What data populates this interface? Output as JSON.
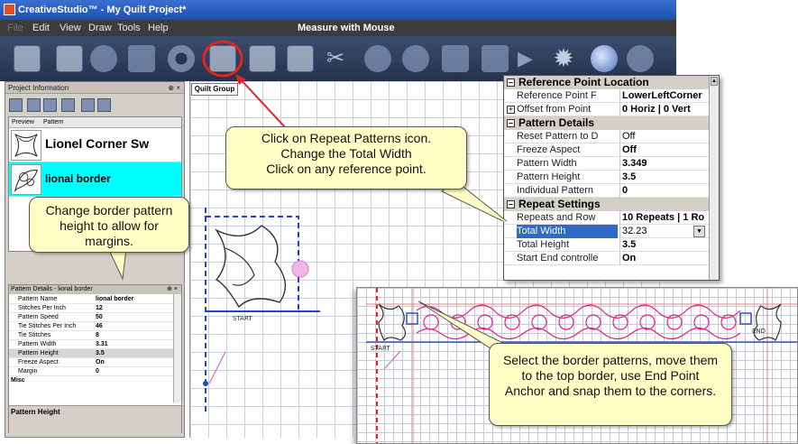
{
  "window": {
    "title": "CreativeStudio™ - My Quilt Project*"
  },
  "menubar": {
    "items": [
      "File",
      "Edit",
      "View",
      "Draw",
      "Tools",
      "Help"
    ],
    "mode_title": "Measure with Mouse"
  },
  "project_panel": {
    "header": "Project Information",
    "pin": "⊕ ×",
    "columns": [
      "Preview",
      "Pattern"
    ],
    "patterns": [
      {
        "name": "Lionel Corner Sw",
        "selected": false
      },
      {
        "name": "lional border",
        "selected": true
      }
    ]
  },
  "pattern_details": {
    "header": "Pattern Details - lional border",
    "pin": "⊕ ×",
    "rows": [
      {
        "label": "Pattern Name",
        "value": "lional border"
      },
      {
        "label": "Stitches Per Inch",
        "value": "12"
      },
      {
        "label": "Pattern Speed",
        "value": "50"
      },
      {
        "label": "Tie Stitches Per Inch",
        "value": "46"
      },
      {
        "label": "Tie Stitches",
        "value": "8"
      },
      {
        "label": "Pattern Width",
        "value": "3.31"
      },
      {
        "label": "Pattern Height",
        "value": "3.5"
      },
      {
        "label": "Freeze Aspect",
        "value": "On"
      },
      {
        "label": "Margin",
        "value": "0"
      }
    ],
    "misc_section": "Misc",
    "footer": "Pattern Height"
  },
  "canvas": {
    "tab": "Quilt Group",
    "start_label": "START"
  },
  "property_grid": {
    "sections": [
      {
        "title": "Reference Point Location",
        "rows": [
          {
            "label": "Reference Point F",
            "value": "LowerLeftCorner",
            "expand": false
          },
          {
            "label": "Offset from Point",
            "value": "0 Horiz | 0 Vert",
            "expand": true
          }
        ]
      },
      {
        "title": "Pattern Details",
        "rows": [
          {
            "label": "Reset Pattern to D",
            "value": "Off"
          },
          {
            "label": "Freeze Aspect",
            "value": "Off"
          },
          {
            "label": "Pattern Width",
            "value": "3.349"
          },
          {
            "label": "Pattern Height",
            "value": "3.5"
          },
          {
            "label": "Individual Pattern",
            "value": "0"
          }
        ]
      },
      {
        "title": "Repeat Settings",
        "rows": [
          {
            "label": "Repeats and Row",
            "value": "10 Repeats | 1 Ro"
          },
          {
            "label": "Total Width",
            "value": "32.23",
            "selected": true
          },
          {
            "label": "Total Height",
            "value": "3.5"
          },
          {
            "label": "Start End controlle",
            "value": "On"
          }
        ]
      }
    ]
  },
  "inset": {
    "start_label": "START",
    "end_label": "END"
  },
  "callouts": {
    "repeat": "Click on Repeat Patterns icon.\nChange the Total Width\nClick on any reference point.",
    "height": "Change border pattern height to allow for margins.",
    "select": "Select the border patterns, move them to the top border, use End Point Anchor and snap them to the corners."
  },
  "colors": {
    "selection_cyan": "#00ffff",
    "callout_fill": "#ffffc6",
    "highlight_red": "#e32222",
    "border_pattern_magenta": "#e0208c"
  }
}
